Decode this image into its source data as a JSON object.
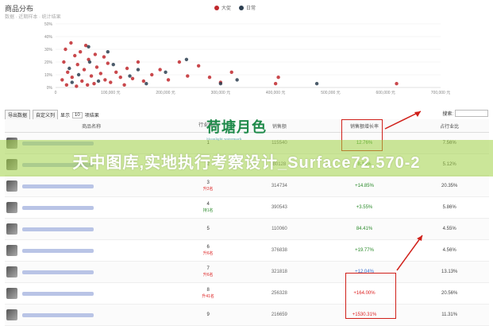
{
  "chart": {
    "title": "商品分布",
    "subtitle": "数据 · 近期样本 · 统计结果",
    "legend": [
      {
        "label": "大促",
        "color": "#c0282d"
      },
      {
        "label": "日常",
        "color": "#2c3e50"
      }
    ]
  },
  "chart_data": {
    "type": "scatter",
    "x_ticks": [
      "0",
      "100,000 元",
      "200,000 元",
      "300,000 元",
      "400,000 元",
      "500,000 元",
      "600,000 元",
      "700,000 元"
    ],
    "y_ticks": [
      "0%",
      "10%",
      "20%",
      "30%",
      "40%",
      "50%"
    ],
    "xlim": [
      0,
      700000
    ],
    "ylim": [
      0,
      50
    ],
    "series": [
      {
        "name": "大促",
        "color": "#c0282d",
        "points": [
          [
            15000,
            20
          ],
          [
            22000,
            12
          ],
          [
            30000,
            8
          ],
          [
            35000,
            25
          ],
          [
            40000,
            18
          ],
          [
            48000,
            5
          ],
          [
            52000,
            14
          ],
          [
            60000,
            22
          ],
          [
            65000,
            9
          ],
          [
            70000,
            3
          ],
          [
            75000,
            16
          ],
          [
            82000,
            11
          ],
          [
            90000,
            6
          ],
          [
            95000,
            19
          ],
          [
            100000,
            4
          ],
          [
            110000,
            12
          ],
          [
            118000,
            8
          ],
          [
            125000,
            2
          ],
          [
            130000,
            15
          ],
          [
            140000,
            7
          ],
          [
            150000,
            20
          ],
          [
            160000,
            5
          ],
          [
            175000,
            10
          ],
          [
            190000,
            14
          ],
          [
            205000,
            6
          ],
          [
            225000,
            20
          ],
          [
            240000,
            9
          ],
          [
            260000,
            17
          ],
          [
            280000,
            8
          ],
          [
            300000,
            4
          ],
          [
            320000,
            12
          ],
          [
            400000,
            3
          ],
          [
            405000,
            8
          ],
          [
            620000,
            3
          ],
          [
            18000,
            30
          ],
          [
            28000,
            35
          ],
          [
            45000,
            28
          ],
          [
            55000,
            33
          ],
          [
            72000,
            26
          ],
          [
            88000,
            24
          ],
          [
            12000,
            6
          ],
          [
            20000,
            2
          ],
          [
            38000,
            1
          ],
          [
            58000,
            2
          ]
        ]
      },
      {
        "name": "日常",
        "color": "#2c3e50",
        "points": [
          [
            25000,
            15
          ],
          [
            42000,
            10
          ],
          [
            62000,
            20
          ],
          [
            78000,
            5
          ],
          [
            105000,
            18
          ],
          [
            135000,
            9
          ],
          [
            165000,
            3
          ],
          [
            200000,
            12
          ],
          [
            238000,
            22
          ],
          [
            300000,
            3
          ],
          [
            330000,
            6
          ],
          [
            475000,
            3
          ],
          [
            60000,
            32
          ],
          [
            95000,
            28
          ],
          [
            150000,
            14
          ],
          [
            30000,
            4
          ]
        ]
      }
    ]
  },
  "toolbar": {
    "btn1": "导出数据",
    "btn2": "自定义列",
    "show_label": "显示",
    "show_value": "10",
    "show_suffix": "项结果",
    "search_label": "搜索:"
  },
  "table": {
    "headers": {
      "name": "商品名称",
      "rank": "行业排名",
      "sales": "销售额",
      "growth": "销售额增长率",
      "share": "占行业比"
    },
    "rows": [
      {
        "rank": "1",
        "change": "",
        "sales": "115540",
        "growth": "12.76%",
        "share": "7.56%",
        "gclass": "g-pos",
        "cclass": ""
      },
      {
        "rank": "2",
        "change": "",
        "sales": "80128",
        "growth": "8.34%",
        "share": "5.12%",
        "gclass": "g-pos",
        "cclass": ""
      },
      {
        "rank": "3",
        "change": "升2名",
        "sales": "314734",
        "growth": "+14.85%",
        "share": "20.35%",
        "gclass": "g-pos",
        "cclass": "chg-down"
      },
      {
        "rank": "4",
        "change": "持1名",
        "sales": "390543",
        "growth": "+3.55%",
        "share": "5.86%",
        "gclass": "g-pos",
        "cclass": "chg-up"
      },
      {
        "rank": "5",
        "change": "",
        "sales": "110060",
        "growth": "84.41%",
        "share": "4.55%",
        "gclass": "g-pos",
        "cclass": ""
      },
      {
        "rank": "6",
        "change": "升6名",
        "sales": "376838",
        "growth": "+19.77%",
        "share": "4.56%",
        "gclass": "g-pos",
        "cclass": "chg-down"
      },
      {
        "rank": "7",
        "change": "升6名",
        "sales": "321818",
        "growth": "+12.04%",
        "share": "13.13%",
        "gclass": "g-blue",
        "cclass": "chg-down"
      },
      {
        "rank": "8",
        "change": "升41名",
        "sales": "256328",
        "growth": "+164.00%",
        "share": "20.56%",
        "gclass": "g-neg",
        "cclass": "chg-down"
      },
      {
        "rank": "9",
        "change": "",
        "sales": "216659",
        "growth": "+1530.31%",
        "share": "11.31%",
        "gclass": "g-neg",
        "cclass": ""
      }
    ]
  },
  "overlay": {
    "banner_text": "天中图库,实地执行考察设计_Surface72.570-2",
    "logo_text": "荷塘月色",
    "logo_sub": "Moonlight watermark"
  }
}
